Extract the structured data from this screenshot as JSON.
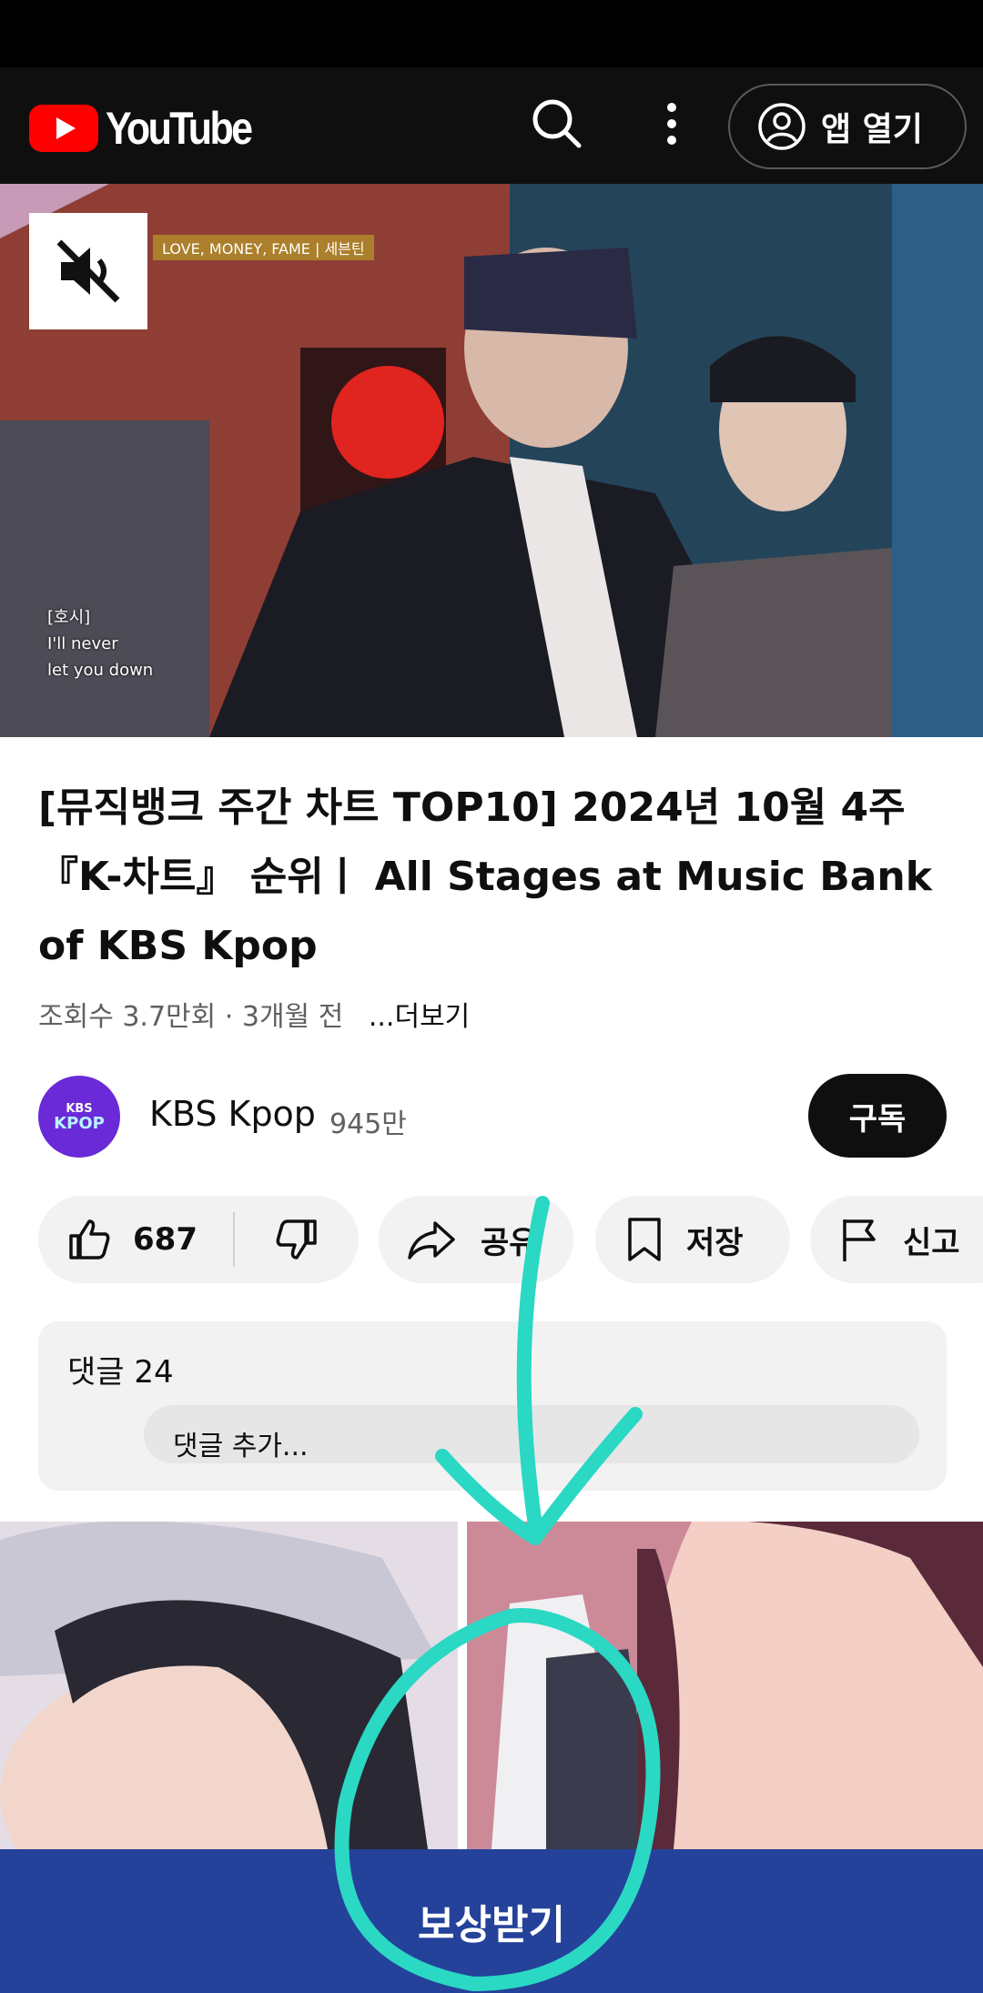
{
  "app": {
    "logo_text": "YouTube",
    "brand_red": "#ff0000",
    "open_app_label": "앱 열기"
  },
  "player": {
    "song_caption": "LOVE, MONEY, FAME | 세븐틴",
    "lyric_lines": [
      "[호시]",
      "I'll never",
      "let you down"
    ],
    "muted": true
  },
  "video": {
    "title": "[뮤직뱅크 주간 차트 TOP10] 2024년 10월 4주 『K-차트』 순위ㅣ All Stages at Music Bank of KBS Kpop",
    "views": "조회수 3.7만회",
    "age": "3개월 전",
    "more_label": "...더보기"
  },
  "channel": {
    "avatar_text_1": "KBS",
    "avatar_text_2": "KPOP",
    "name": "KBS Kpop",
    "subscribers": "945만",
    "subscribe_label": "구독"
  },
  "actions": {
    "like_count": "687",
    "share_label": "공유",
    "save_label": "저장",
    "report_label": "신고"
  },
  "comments": {
    "count_label": "댓글 24",
    "input_placeholder": "댓글 추가..."
  },
  "promo": {
    "button_label": "보상받기",
    "accent_color": "#24429a"
  },
  "annotation": {
    "color": "#2ad8c4",
    "shapes": [
      "arrow",
      "circle"
    ]
  }
}
